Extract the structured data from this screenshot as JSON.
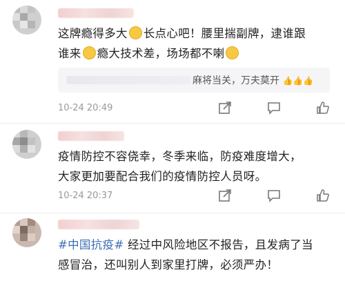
{
  "comments": [
    {
      "text_line1": "这牌瘾得多大",
      "text_line1b": "长点心吧！腰里揣副牌，逮谁跟",
      "text_line2": "谁来",
      "text_line2b": "瘾大技术差，场场都不喇",
      "reply_text": "麻将当关，万夫莫开",
      "reply_emojis": "👍👍👍",
      "time": "10-24 20:49"
    },
    {
      "text_line1": "疫情防控不容侥幸，冬季来临，防疫难度增大，",
      "text_line2": "大家更加要配合我们的疫情防控人员呀。",
      "time": "10-24 20:37"
    },
    {
      "hashtag": "#中国抗疫#",
      "text_line1": " 经过中风险地区不报告，且发病了当",
      "text_line2": "感冒治，还叫别人到家里打牌，必须严办！"
    }
  ],
  "icons": [
    "share-icon",
    "comment-icon",
    "like-icon"
  ],
  "colors": {
    "hashtag": "#3d6fb4",
    "time": "#999999",
    "reply_bg": "#f5f5f7"
  }
}
